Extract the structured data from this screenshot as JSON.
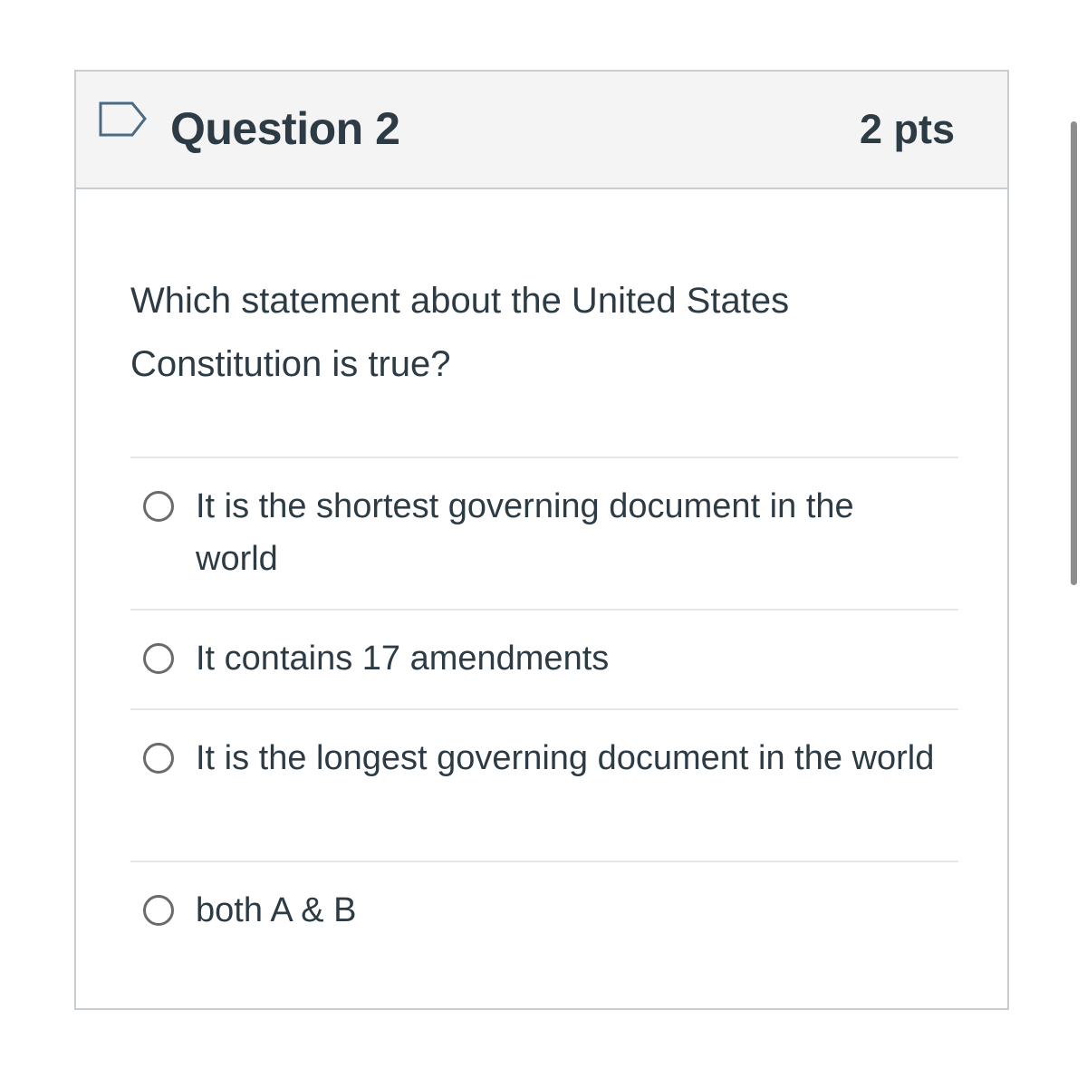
{
  "question": {
    "title": "Question 2",
    "points": "2 pts",
    "text": "Which statement about the United States Constitution is true?"
  },
  "answers": [
    {
      "label": "It is the shortest governing document in the world",
      "selected": false
    },
    {
      "label": "It contains 17 amendments",
      "selected": false
    },
    {
      "label": "It is the longest governing document in the world",
      "selected": false
    },
    {
      "label": "both A & B",
      "selected": false
    }
  ],
  "icons": {
    "flag": "flag-outline-icon"
  },
  "colors": {
    "text": "#2d3b45",
    "header_bg": "#f4f4f4",
    "border": "#c7cdd1",
    "flag": "#4a6b85"
  }
}
